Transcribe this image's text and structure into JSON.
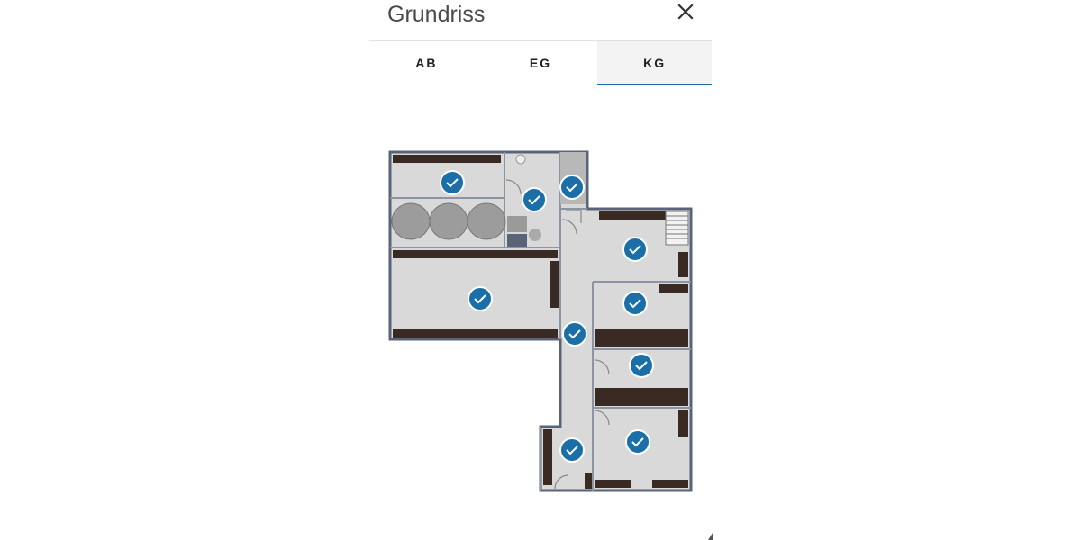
{
  "dialog": {
    "title": "Grundriss",
    "close_icon": "close-icon"
  },
  "tabs": [
    {
      "label": "AB",
      "active": false
    },
    {
      "label": "EG",
      "active": false
    },
    {
      "label": "KG",
      "active": true
    }
  ],
  "floorplan": {
    "room_markers": 10,
    "marker_icon": "check-circle-icon",
    "colors": {
      "marker_fill": "#1a6fa8",
      "wall": "#5a6478",
      "floor": "#d8d8d8",
      "furniture": "#3a2a24",
      "accent": "#1a6fa8"
    }
  }
}
